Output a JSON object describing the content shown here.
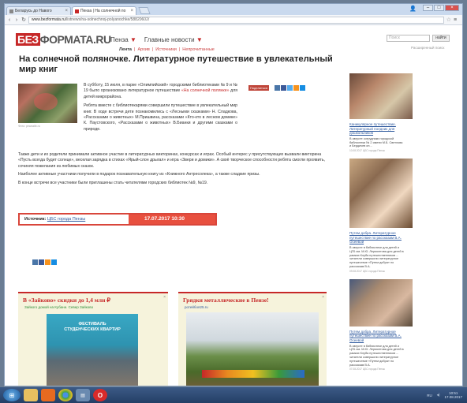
{
  "browser": {
    "tabs": [
      {
        "label": "Беларусь до Навого"
      },
      {
        "label": "Пенза | На солнечной по"
      }
    ],
    "url_domain": "www.bezformata.ru",
    "url_rest": "/listnews/na-solnechnoj-polyanochke/58820602/"
  },
  "site": {
    "logo_be": "БЕЗ",
    "logo_rest": "ФОРМАТА.RU",
    "nav_city": "Пенза",
    "nav_main": "Главные новости",
    "subnav": [
      "Лента",
      "Архив",
      "Источники",
      "Непрочитанные"
    ],
    "search_placeholder": "Поиск",
    "search_button": "найти",
    "advanced_search": "Расширенный поиск"
  },
  "article": {
    "title": "На солнечной поляночке. Литературное путешествие в увлекательный мир книг",
    "photo_caption": "Фото: pewzalib.ru",
    "share_label": "Поделиться",
    "lead_1": "В субботу, 15 июля, в парке «Олимпийский» городскими библиотеками № 9 и № 19 было организовано литературное путешествие ",
    "lead_link": "«На солнечной полянке»",
    "lead_2": " для детей микрорайона.",
    "lead_3": "Ребята вместе с библиотекарями совершили путешествие в увлекательный мир книг. В ходе встречи дети познакомились с «Лесными сказками» Н. Сладкова, «Рассказами о животных» М.Пришвина, рассказами «Кто-кто в лесном домике» К. Паустовского, «Рассказами о животных» В.Бианки и другими сказками о природе.",
    "body_1": "Также дети и их родители принимали активное участие в литературных викторинах, конкурсах и играх. Особый интерес у присутствующих вызвали викторина «Пусть всегда будет солнце», веселая зарядка в стихах «Ярый-слон дрыгал» и игра «Звери и домики». А своё творческое способности ребята смогли проявить, сочиняя пожелания из любимых сказок.",
    "body_2": "Наиболее активные участники получили в подарок познавательную книгу из «Книжного Антресолека», а также сладкие призы.",
    "body_3": "В конце встречи все участники были приглашены стать читателями городских библиотек №9, №19.",
    "source_label": "Источник:",
    "source_name": "ЦБС города Пензы",
    "date": "17.07.2017  10:30"
  },
  "ads": [
    {
      "title": "В «Зайково» скидки до 1,4 млн ₽",
      "sub": "Зайкого домой на Кубани. Север Зайково",
      "img_line1": "ФЕСТИВАЛЬ",
      "img_line2": "СТУДЕНЧЕСКИХ КВАРТИР"
    },
    {
      "title": "Грядки металлические в Пензе!",
      "sub": "ротейбоя25.ru"
    }
  ],
  "sidebar": [
    {
      "title": "Каникулярное путешествие. Литературный полдник для дошкольников",
      "text": "В августе сотрудники городской библиотеки № 2 имени М.Б. Светлова и Бердичев он...",
      "date": "10.08.2017 ЦБС города Пензы"
    },
    {
      "title": "Путем добра. Литературное путешествие по рассказам В.А. Осеевой",
      "text": "В августе в библиотеке для детей и ЦГБ им. М.Ю. Лермонтова для детей в рамках Клуба путешественников ... читатели совершили литературное путешествие «Путем добра» по рассказам В.А.",
      "date": "09.08.2017 ЦБС города Пензы"
    },
    {
      "title": "Путем добра. Литературное путешествие по рассказам В.А. Осеевой",
      "text": "В августе в библиотеке для детей и ЦГБ им. М.Ю. Лермонтова для детей в рамках Клуба путешественников ... читатели совершили литературное путешествие «Путем добра» по рассказам В.А.",
      "date": "07.08.2017 ЦБС города Пензы"
    }
  ],
  "taskbar": {
    "lang": "RU",
    "time": "10:51",
    "date": "17.08.2017"
  },
  "colors": {
    "brand_red": "#c62828",
    "date_bar": "#e8503f",
    "link_blue": "#2f5a9e"
  }
}
